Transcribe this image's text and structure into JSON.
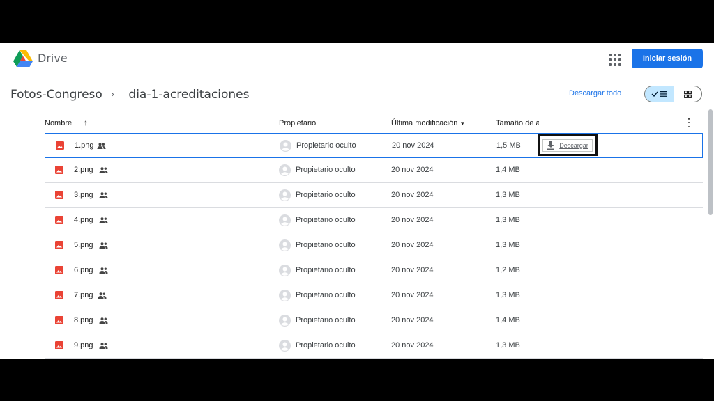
{
  "header": {
    "brand": "Drive",
    "signin_label": "Iniciar sesión"
  },
  "breadcrumb": {
    "parent": "Fotos-Congreso",
    "current": "dia-1-acreditaciones"
  },
  "toolbar": {
    "download_all": "Descargar todo",
    "view_list_icon": "check-list-icon",
    "view_grid_icon": "grid-icon"
  },
  "table": {
    "headers": {
      "name": "Nombre",
      "owner": "Propietario",
      "modified": "Última modificación",
      "size": "Tamaño de archivo"
    },
    "hover_download_label": "Descargar",
    "rows": [
      {
        "name": "1.png",
        "owner": "Propietario oculto",
        "modified": "20 nov 2024",
        "size": "1,5 MB"
      },
      {
        "name": "2.png",
        "owner": "Propietario oculto",
        "modified": "20 nov 2024",
        "size": "1,4 MB"
      },
      {
        "name": "3.png",
        "owner": "Propietario oculto",
        "modified": "20 nov 2024",
        "size": "1,3 MB"
      },
      {
        "name": "4.png",
        "owner": "Propietario oculto",
        "modified": "20 nov 2024",
        "size": "1,3 MB"
      },
      {
        "name": "5.png",
        "owner": "Propietario oculto",
        "modified": "20 nov 2024",
        "size": "1,3 MB"
      },
      {
        "name": "6.png",
        "owner": "Propietario oculto",
        "modified": "20 nov 2024",
        "size": "1,2 MB"
      },
      {
        "name": "7.png",
        "owner": "Propietario oculto",
        "modified": "20 nov 2024",
        "size": "1,3 MB"
      },
      {
        "name": "8.png",
        "owner": "Propietario oculto",
        "modified": "20 nov 2024",
        "size": "1,4 MB"
      },
      {
        "name": "9.png",
        "owner": "Propietario oculto",
        "modified": "20 nov 2024",
        "size": "1,3 MB"
      }
    ]
  },
  "colors": {
    "accent": "#1a73e8",
    "image_icon": "#ea4335",
    "selected_toggle": "#c2e7ff"
  }
}
